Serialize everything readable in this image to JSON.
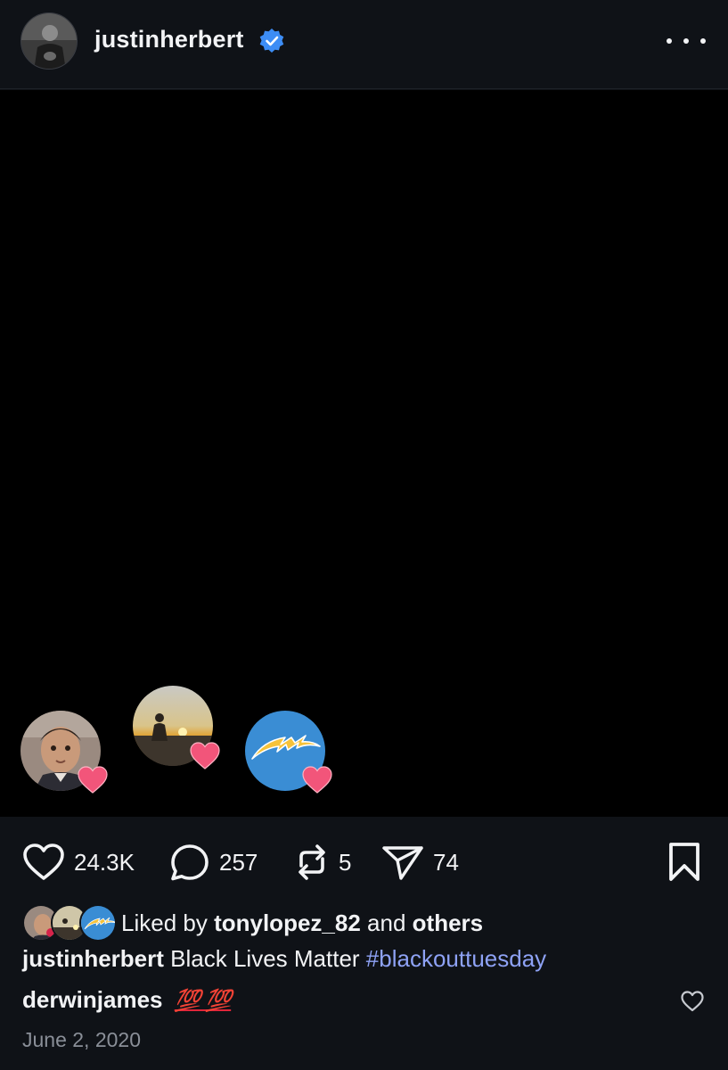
{
  "header": {
    "username": "justinherbert"
  },
  "icons": {
    "verified": "verified-badge-icon",
    "more": "more-options-icon",
    "like": "heart-icon",
    "comment": "comment-icon",
    "repost": "repost-icon",
    "share": "send-icon",
    "save": "bookmark-icon"
  },
  "colors": {
    "background": "#0f1217",
    "media": "#000000",
    "verified": "#3d8df5",
    "hashtag": "#8ea2f5",
    "heart_badge": "#f2557a",
    "chargers_blue": "#3a8dd4",
    "bolt": "#f5c23a"
  },
  "actions": {
    "likes_count": "24.3K",
    "comments_count": "257",
    "reposts_count": "5",
    "shares_count": "74"
  },
  "likes": {
    "prefix": "Liked by",
    "user": "tonylopez_82",
    "connector": "and",
    "others": "others"
  },
  "caption": {
    "username": "justinherbert",
    "text": "Black Lives Matter",
    "hashtag": "#blackouttuesday"
  },
  "comment": {
    "username": "derwinjames",
    "emoji": "💯 💯"
  },
  "date": "June 2, 2020"
}
